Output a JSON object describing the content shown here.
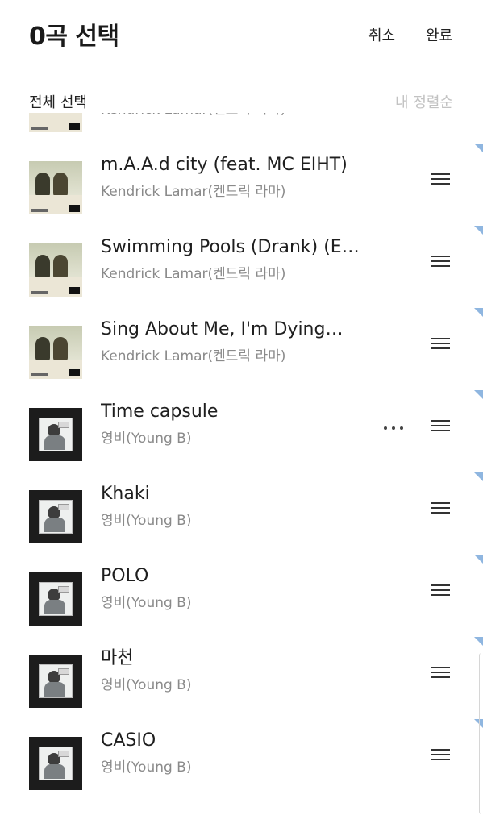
{
  "header": {
    "title": "0곡 선택",
    "cancel_label": "취소",
    "done_label": "완료"
  },
  "subbar": {
    "select_all_label": "전체 선택",
    "sort_label": "내 정렬순"
  },
  "tracks": [
    {
      "title": "",
      "artist": "Kendrick Lamar(켄드릭 라마)",
      "art": "kendrick",
      "show_more": false
    },
    {
      "title": "m.A.A.d city (feat. MC EIHT)",
      "artist": "Kendrick Lamar(켄드릭 라마)",
      "art": "kendrick",
      "show_more": false
    },
    {
      "title": "Swimming Pools (Drank) (E…",
      "artist": "Kendrick Lamar(켄드릭 라마)",
      "art": "kendrick",
      "show_more": false
    },
    {
      "title": "Sing About Me, I'm Dying…",
      "artist": "Kendrick Lamar(켄드릭 라마)",
      "art": "kendrick",
      "show_more": false
    },
    {
      "title": "Time capsule",
      "artist": "영비(Young B)",
      "art": "youngb",
      "show_more": true
    },
    {
      "title": "Khaki",
      "artist": "영비(Young B)",
      "art": "youngb",
      "show_more": false
    },
    {
      "title": "POLO",
      "artist": "영비(Young B)",
      "art": "youngb",
      "show_more": false
    },
    {
      "title": "마천",
      "artist": "영비(Young B)",
      "art": "youngb",
      "show_more": false
    },
    {
      "title": "CASIO",
      "artist": "영비(Young B)",
      "art": "youngb",
      "show_more": false
    }
  ],
  "colors": {
    "accent_corner": "#8fb6e0",
    "artist_text": "#8a8a8a",
    "sort_text": "#c2c2c2"
  },
  "icons": {
    "row_more": "more-horizontal-icon",
    "row_handle": "drag-handle-icon"
  }
}
